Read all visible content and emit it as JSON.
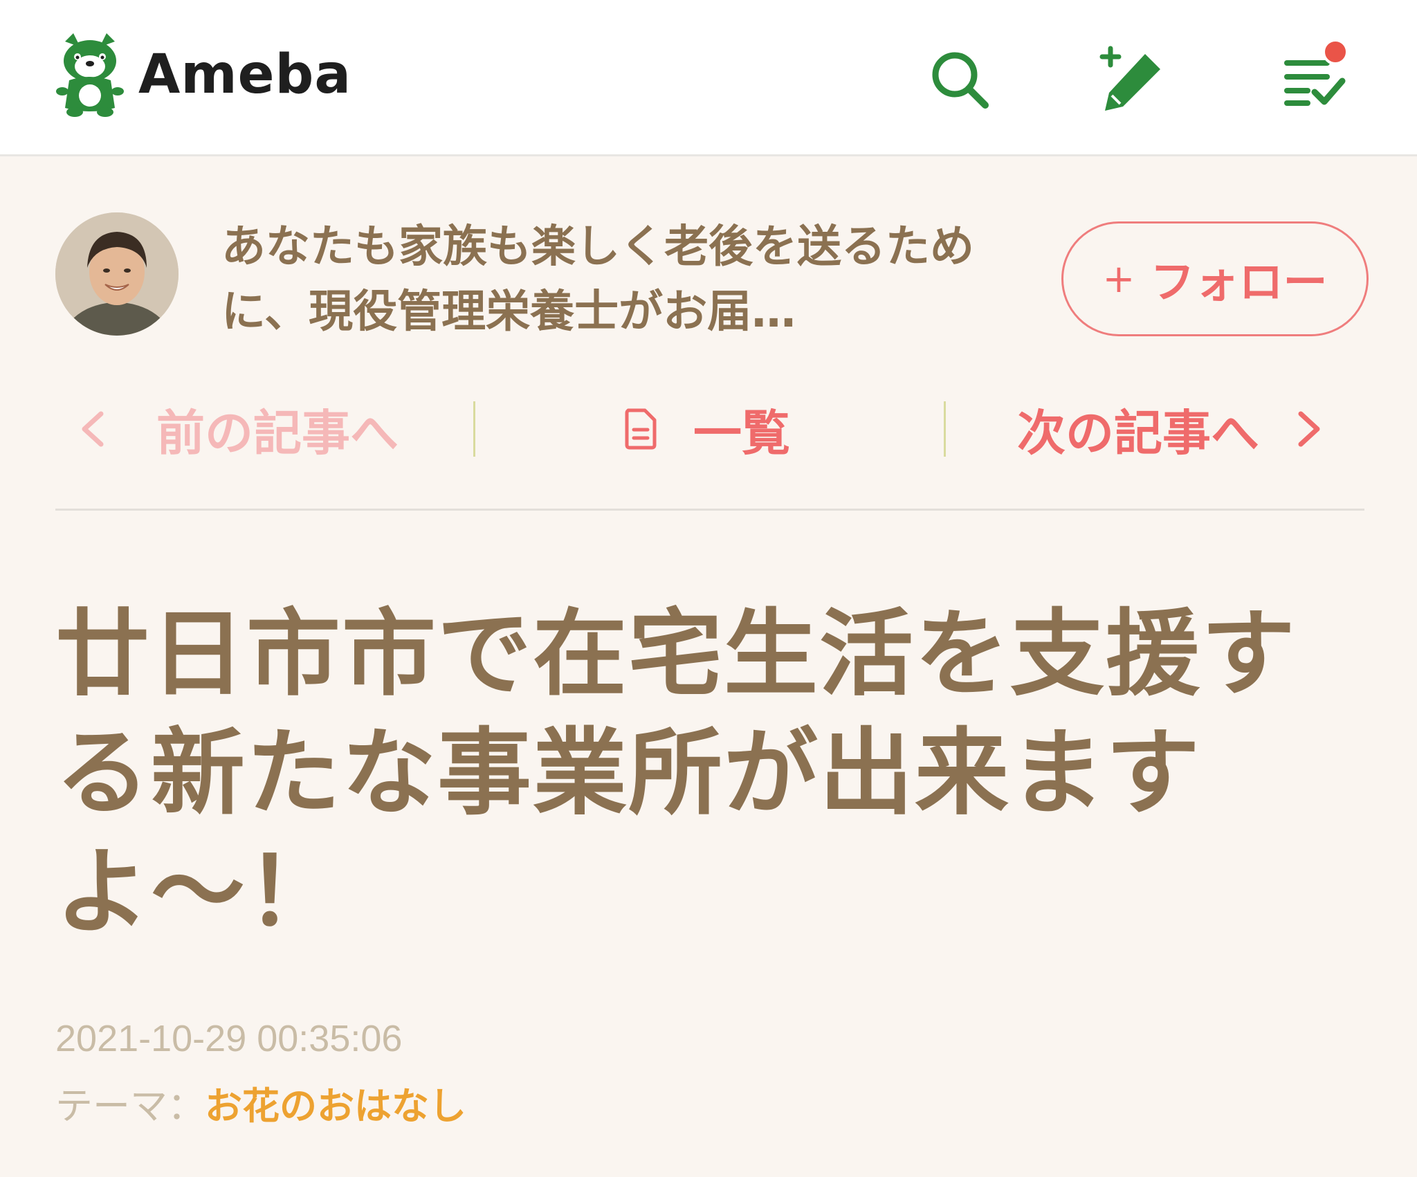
{
  "header": {
    "logo_text": "Ameba",
    "logo_icon": "ameba-dog-logo",
    "search_icon": "search-icon",
    "write_icon": "write-pencil-icon",
    "feed_icon": "checklist-feed-icon",
    "has_notification": true
  },
  "blog": {
    "title": "あなたも家族も楽しく老後を送るために、現役管理栄養士がお届…",
    "follow_plus": "+",
    "follow_label": "フォロー"
  },
  "nav": {
    "prev_arrow": "<",
    "prev_label": "前の記事へ",
    "list_label": "一覧",
    "next_label": "次の記事へ",
    "next_arrow": ">"
  },
  "article": {
    "title": "廿日市市で在宅生活を支援する新たな事業所が出来ますよ〜！",
    "date": "2021-10-29 00:35:06",
    "theme_prefix": "テーマ：",
    "theme": "お花のおはなし"
  },
  "colors": {
    "brand_green": "#2d8c3c",
    "accent_pink": "#ef6b6b",
    "title_brown": "#8b7151",
    "theme_orange": "#eda231",
    "background": "#faf5f0"
  }
}
